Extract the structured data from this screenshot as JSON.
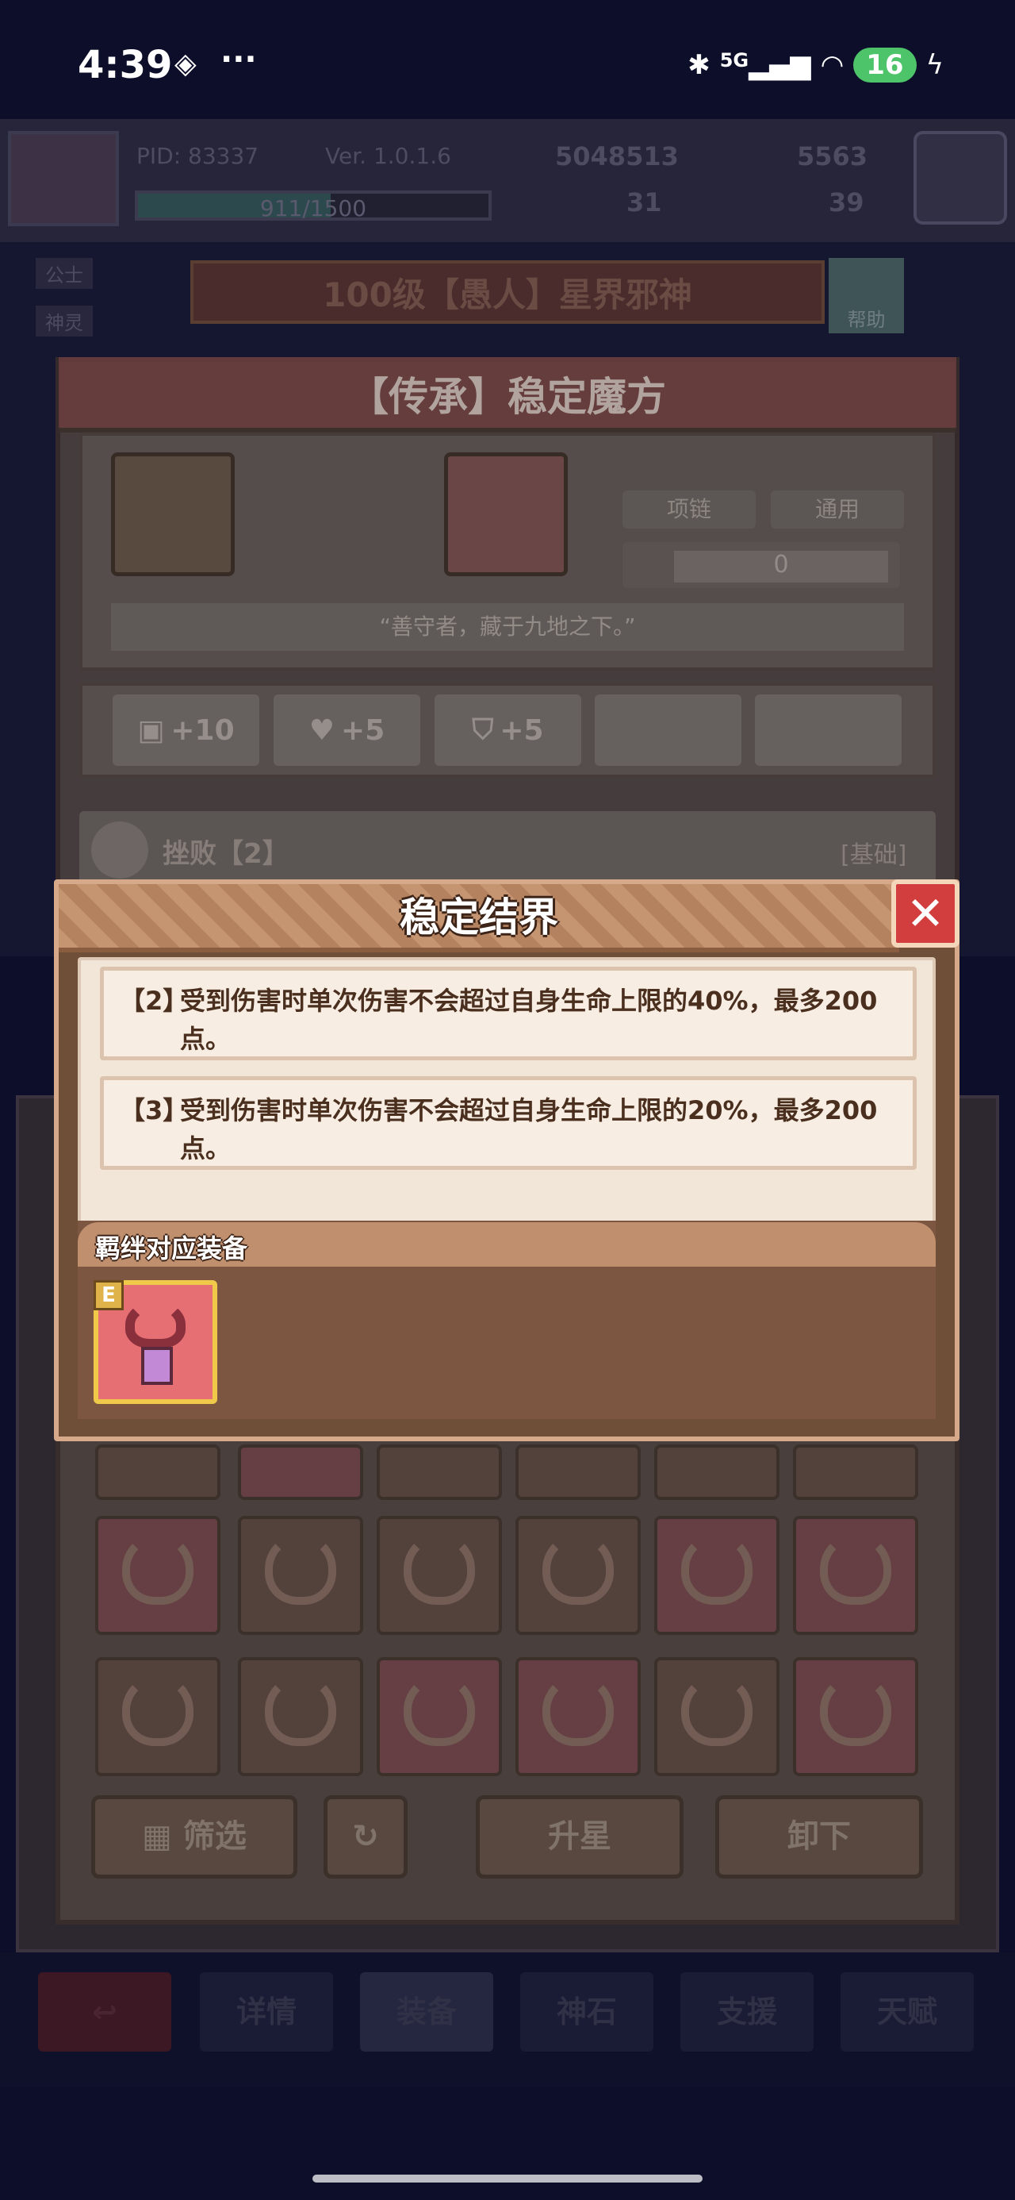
{
  "status_bar": {
    "time": "4:39",
    "signal": "5G",
    "battery": "16"
  },
  "player": {
    "pid": "PID: 83337",
    "version": "Ver. 1.0.1.6",
    "hp": "911/1500",
    "gold": "5048513",
    "gems": "5563",
    "clover": "31",
    "boot": "39"
  },
  "side_chips": [
    "公士",
    "神灵"
  ],
  "bg_title": "100级【愚人】星界邪神",
  "help_label": "帮助",
  "panel": {
    "title": "【传承】稳定魔方",
    "tags": [
      "项链",
      "通用"
    ],
    "count": "0",
    "quote": "“善守者，藏于九地之下。”",
    "bonuses": [
      "+10",
      "+5",
      "+5"
    ],
    "defeat_name": "挫败【2】",
    "defeat_tag": "[基础]",
    "actions": [
      "筛选",
      "升星",
      "卸下"
    ]
  },
  "modal": {
    "title": "稳定结界",
    "rules": [
      {
        "num": "【2】",
        "text": "受到伤害时单次伤害不会超过自身生命上限的40%，最多200点。"
      },
      {
        "num": "【3】",
        "text": "受到伤害时单次伤害不会超过自身生命上限的20%，最多200点。"
      }
    ],
    "equip_label": "羁绊对应装备",
    "equip_badge": "E"
  },
  "bottom_tabs": [
    "详情",
    "装备",
    "神石",
    "支援",
    "天赋"
  ],
  "colors": {
    "close_button": "#d23d3d",
    "modal_frame": "#6f4f38",
    "equip_item": "#e66f74"
  }
}
